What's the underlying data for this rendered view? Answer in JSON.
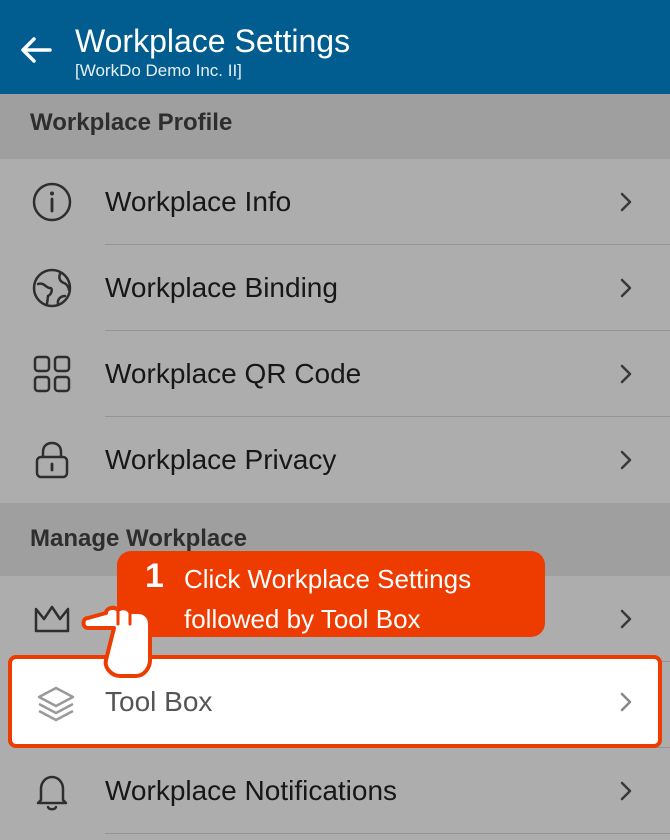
{
  "appbar": {
    "title": "Workplace Settings",
    "subtitle": "[WorkDo Demo Inc. II]",
    "back_icon": "arrow-left-icon",
    "background": "#015d8f"
  },
  "sections": [
    {
      "header": "Workplace Profile",
      "items": [
        {
          "label": "Workplace Info",
          "icon": "info-icon"
        },
        {
          "label": "Workplace Binding",
          "icon": "globe-icon"
        },
        {
          "label": "Workplace QR Code",
          "icon": "qr-code-icon"
        },
        {
          "label": "Workplace Privacy",
          "icon": "lock-icon"
        }
      ]
    },
    {
      "header": "Manage Workplace",
      "items": [
        {
          "label": "",
          "icon": "crown-icon"
        },
        {
          "label": "Tool Box",
          "icon": "layers-icon",
          "highlighted": true
        },
        {
          "label": "Workplace Notifications",
          "icon": "bell-icon"
        }
      ]
    }
  ],
  "tutorial": {
    "step": "1",
    "text_line1": "Click Workplace Settings",
    "text_line2": "followed by Tool Box",
    "accent": "#ee3b00"
  }
}
